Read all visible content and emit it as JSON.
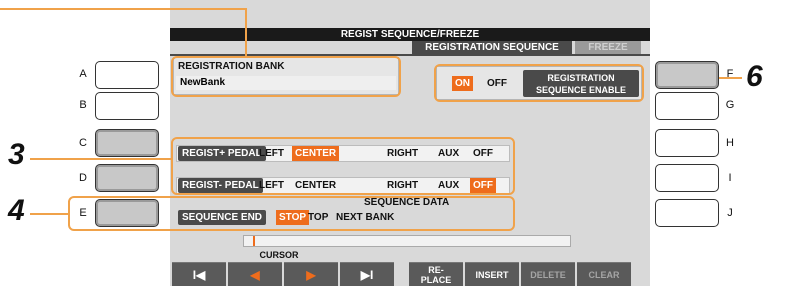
{
  "screen": {
    "title": "REGIST SEQUENCE/FREEZE",
    "tabs": [
      {
        "label": "REGISTRATION SEQUENCE",
        "active": true
      },
      {
        "label": "FREEZE",
        "active": false
      }
    ]
  },
  "registration_bank": {
    "label": "REGISTRATION BANK",
    "value": "NewBank"
  },
  "sequence_enable": {
    "on_label": "ON",
    "off_label": "OFF",
    "selected": "ON",
    "button_line1": "REGISTRATION",
    "button_line2": "SEQUENCE ENABLE"
  },
  "regist_plus_pedal": {
    "label": "REGIST+ PEDAL",
    "options": [
      "LEFT",
      "CENTER",
      "RIGHT",
      "AUX",
      "OFF"
    ],
    "selected": "CENTER"
  },
  "regist_minus_pedal": {
    "label": "REGIST- PEDAL",
    "options": [
      "LEFT",
      "CENTER",
      "RIGHT",
      "AUX",
      "OFF"
    ],
    "selected": "OFF"
  },
  "sequence_data": {
    "header": "SEQUENCE DATA",
    "end_label": "SEQUENCE END",
    "options": [
      "STOP",
      "TOP",
      "NEXT BANK"
    ],
    "selected": "STOP"
  },
  "cursor": {
    "label": "CURSOR",
    "buttons": [
      {
        "icon": "skip-to-start-icon",
        "glyph": "I◀"
      },
      {
        "icon": "arrow-left-icon",
        "glyph": "◀"
      },
      {
        "icon": "arrow-right-icon",
        "glyph": "▶"
      },
      {
        "icon": "skip-to-end-icon",
        "glyph": "▶I"
      }
    ]
  },
  "actions": {
    "replace_line1": "RE-",
    "replace_line2": "PLACE",
    "insert": "INSERT",
    "delete": "DELETE",
    "clear": "CLEAR"
  },
  "side_buttons": {
    "left": [
      "A",
      "B",
      "C",
      "D",
      "E"
    ],
    "right": [
      "F",
      "G",
      "H",
      "I",
      "J"
    ]
  },
  "step_callouts": [
    "3",
    "4",
    "6"
  ],
  "colors": {
    "accent": "#ee6c1c",
    "callout": "#f0a24a",
    "dark_panel": "#4a4a4a",
    "screen_bg": "#d9d9d9"
  }
}
